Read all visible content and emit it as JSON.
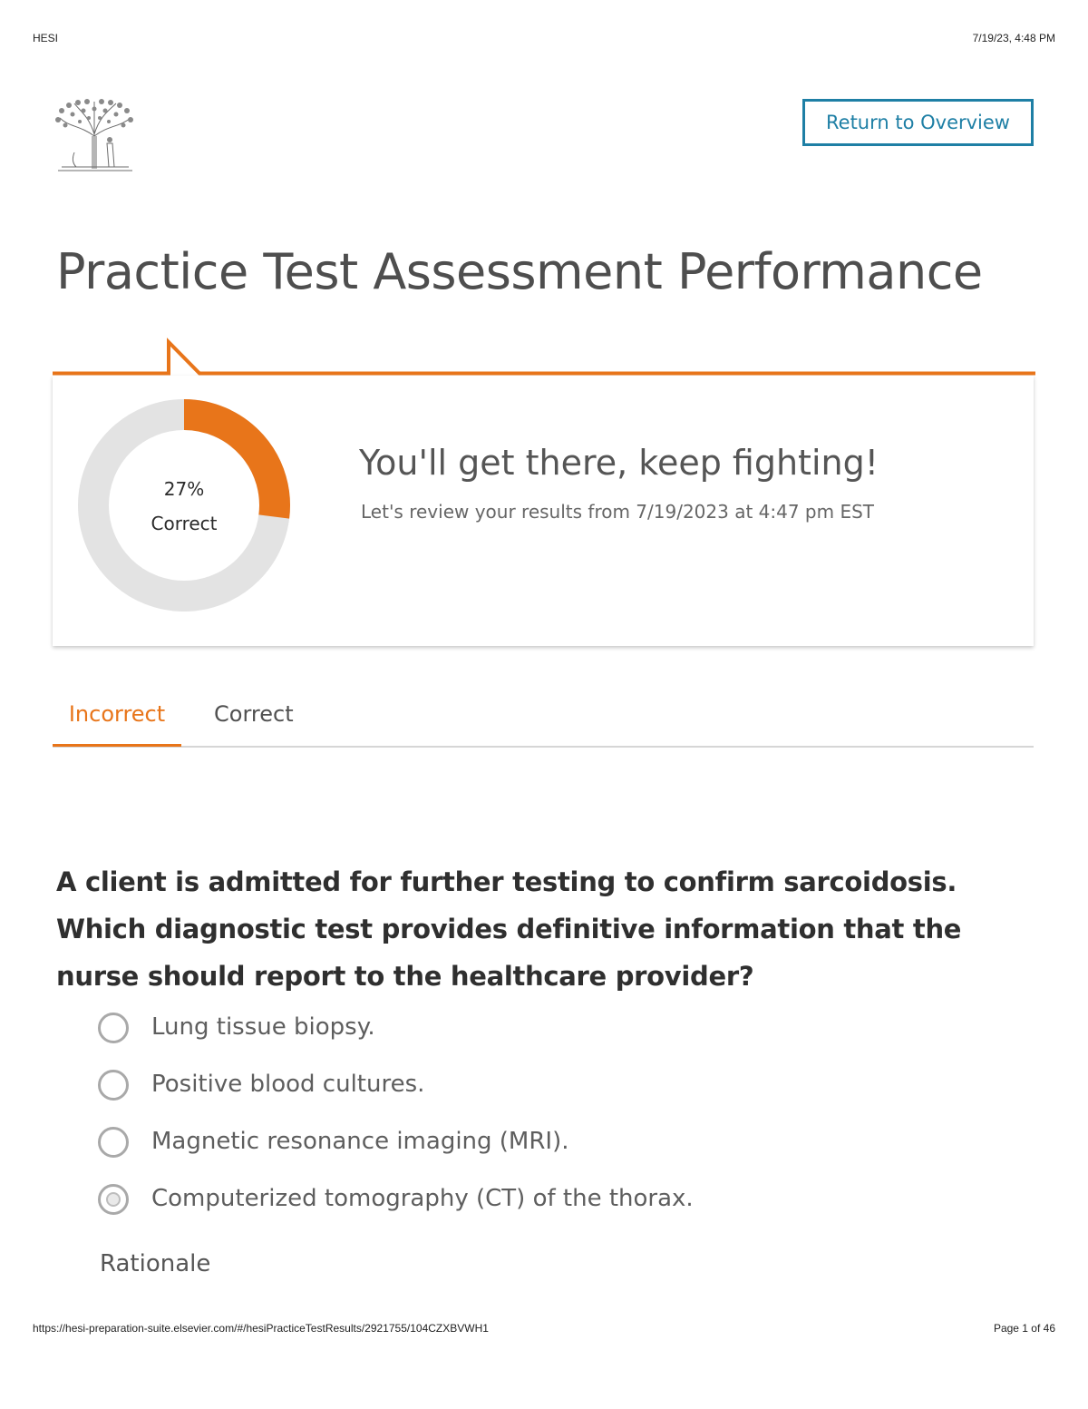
{
  "print_header": {
    "left": "HESI",
    "right": "7/19/23, 4:48 PM"
  },
  "header": {
    "return_button": "Return to Overview"
  },
  "page_title": "Practice Test Assessment Performance",
  "result": {
    "percent_correct": 27,
    "percent_label": "27%",
    "correct_label": "Correct",
    "heading": "You'll get there, keep fighting!",
    "subtext": "Let's review your results from 7/19/2023 at 4:47 pm EST"
  },
  "tabs": [
    {
      "label": "Incorrect",
      "active": true
    },
    {
      "label": "Correct",
      "active": false
    }
  ],
  "question": {
    "text": "A client is admitted for further testing to confirm sarcoidosis. Which diagnostic test provides definitive information that the nurse should report to the healthcare provider?",
    "options": [
      {
        "label": "Lung tissue biopsy.",
        "selected": false
      },
      {
        "label": "Positive blood cultures.",
        "selected": false
      },
      {
        "label": "Magnetic resonance imaging (MRI).",
        "selected": false
      },
      {
        "label": "Computerized tomography (CT) of the thorax.",
        "selected": true
      }
    ],
    "rationale_label": "Rationale"
  },
  "print_footer": {
    "url": "https://hesi-preparation-suite.elsevier.com/#/hesiPracticeTestResults/2921755/104CZXBVWH1",
    "page": "Page 1 of 46"
  },
  "colors": {
    "accent": "#e8751a",
    "link": "#1e7fa5",
    "ring": "#e3e3e3"
  },
  "icons": {
    "logo": "elsevier-tree-logo",
    "radio": "radio-button"
  }
}
